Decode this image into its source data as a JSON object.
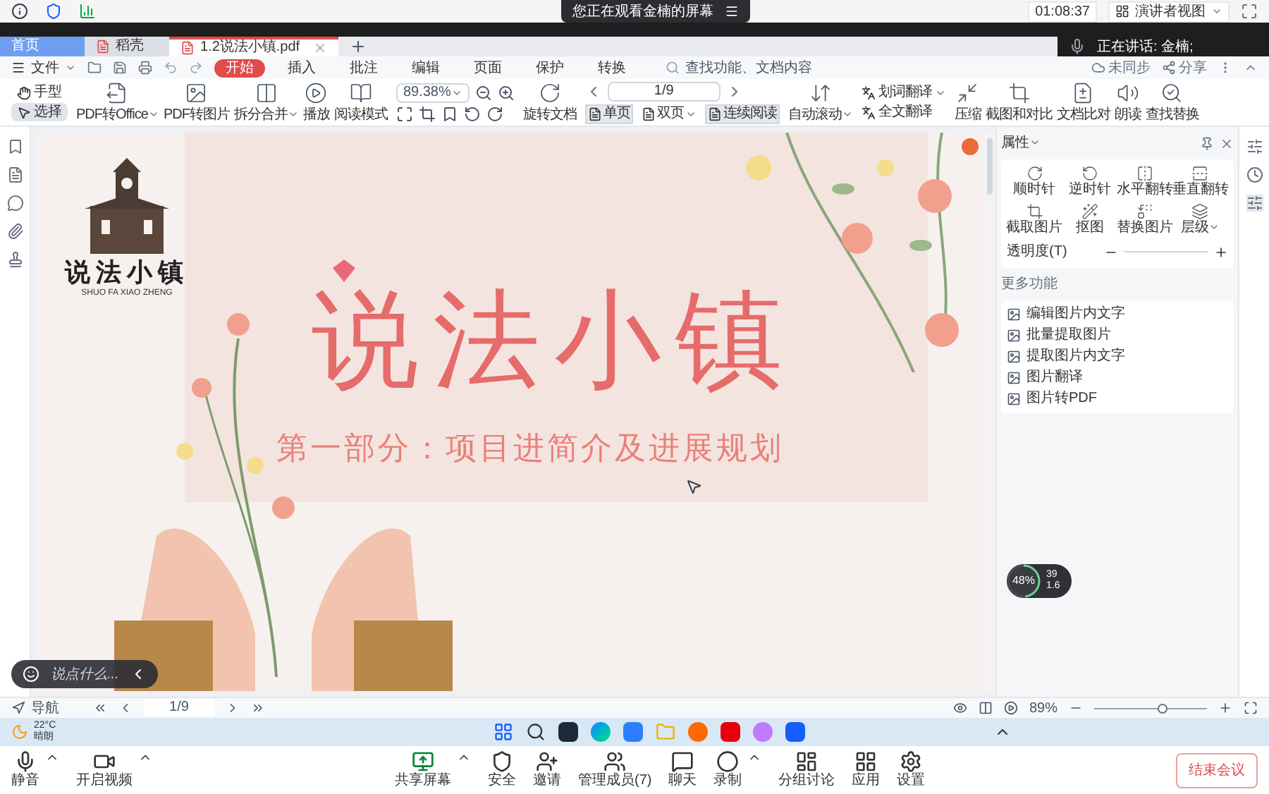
{
  "meeting_top": {
    "banner": "您正在观看金楠的屏幕",
    "time": "01:08:37",
    "view_button": "演讲者视图"
  },
  "speaking": {
    "label": "正在讲话: 金楠;"
  },
  "tabs": [
    {
      "label": "首页",
      "kind": "home",
      "selected": false
    },
    {
      "label": "稻壳",
      "kind": "app",
      "selected": false
    },
    {
      "label": "1.2说法小镇.pdf",
      "kind": "file",
      "selected": true
    }
  ],
  "menu": {
    "file": "文件",
    "items": [
      {
        "label": "开始",
        "selected": true
      },
      {
        "label": "插入",
        "selected": false
      },
      {
        "label": "批注",
        "selected": false
      },
      {
        "label": "编辑",
        "selected": false
      },
      {
        "label": "页面",
        "selected": false
      },
      {
        "label": "保护",
        "selected": false
      },
      {
        "label": "转换",
        "selected": false
      }
    ],
    "search": {
      "placeholder": "查找功能、文档内容"
    },
    "right": [
      "未同步",
      "分享"
    ]
  },
  "ribbon": [
    {
      "kind": "modes",
      "items": [
        {
          "label": "手型",
          "selected": false
        },
        {
          "label": "选择",
          "selected": true
        }
      ]
    },
    {
      "kind": "big",
      "label": "PDF转Office",
      "dropdown": true
    },
    {
      "kind": "big",
      "label": "PDF转图片",
      "dropdown": false
    },
    {
      "kind": "big",
      "label": "拆分合并",
      "dropdown": true
    },
    {
      "kind": "big",
      "label": "播放",
      "dropdown": false
    },
    {
      "kind": "big",
      "label": "阅读模式",
      "dropdown": false
    },
    {
      "kind": "zoom",
      "value": "89.38%"
    },
    {
      "kind": "big",
      "label": "旋转文档",
      "dropdown": false
    },
    {
      "kind": "pager",
      "value": "1/9",
      "items": [
        {
          "label": "单页",
          "selected": true,
          "dropdown": false
        },
        {
          "label": "双页",
          "selected": false,
          "dropdown": true
        },
        {
          "label": "连续阅读",
          "selected": true,
          "dropdown": false
        }
      ]
    },
    {
      "kind": "big",
      "label": "自动滚动",
      "dropdown": true
    },
    {
      "kind": "stack",
      "items": [
        {
          "label": "划词翻译",
          "dropdown": true
        },
        {
          "label": "全文翻译",
          "dropdown": false
        }
      ]
    },
    {
      "kind": "big",
      "label": "压缩",
      "dropdown": false
    },
    {
      "kind": "big",
      "label": "截图和对比",
      "dropdown": false
    },
    {
      "kind": "big",
      "label": "文档比对",
      "dropdown": false
    },
    {
      "kind": "big",
      "label": "朗读",
      "dropdown": false
    },
    {
      "kind": "big",
      "label": "查找替换",
      "dropdown": false
    }
  ],
  "slide": {
    "title": "说法小镇",
    "subtitle": "第一部分：项目进简介及进展规划",
    "logo_text": "说法小镇",
    "logo_subtext": "SHUO FA XIAO ZHENG"
  },
  "chat": {
    "placeholder": "说点什么..."
  },
  "network": {
    "percent": "48%",
    "level": 0.48,
    "up": "39",
    "down": "1.6"
  },
  "panel": {
    "title": "属性",
    "actions": [
      {
        "label": "顺时针",
        "dropdown": false
      },
      {
        "label": "逆时针",
        "dropdown": false
      },
      {
        "label": "水平翻转",
        "dropdown": false
      },
      {
        "label": "垂直翻转",
        "dropdown": false
      },
      {
        "label": "截取图片",
        "dropdown": false
      },
      {
        "label": "抠图",
        "dropdown": false
      },
      {
        "label": "替换图片",
        "dropdown": false
      },
      {
        "label": "层级",
        "dropdown": true
      }
    ],
    "opacity_label": "透明度(T)",
    "more_title": "更多功能",
    "more": [
      "编辑图片内文字",
      "批量提取图片",
      "提取图片内文字",
      "图片翻译",
      "图片转PDF"
    ]
  },
  "status_bar": {
    "nav": "导航",
    "page": "1/9",
    "zoom": "89%",
    "zoom_slider": {
      "level": 0.6
    }
  },
  "taskbar": {
    "temp": "22°C",
    "weather": "晴朗"
  },
  "meeting_toolbar": {
    "left": [
      {
        "label": "静音",
        "kind": "mic",
        "caret": true
      },
      {
        "label": "开启视频",
        "kind": "video",
        "caret": true
      }
    ],
    "center": [
      {
        "label": "共享屏幕",
        "kind": "share",
        "caret": true
      },
      {
        "label": "安全",
        "kind": "shield",
        "caret": false
      },
      {
        "label": "邀请",
        "kind": "invite",
        "caret": false
      },
      {
        "label": "管理成员(7)",
        "kind": "members",
        "caret": false
      },
      {
        "label": "聊天",
        "kind": "chat",
        "caret": false
      },
      {
        "label": "录制",
        "kind": "record",
        "caret": true
      },
      {
        "label": "分组讨论",
        "kind": "breakout",
        "caret": false
      },
      {
        "label": "应用",
        "kind": "apps",
        "caret": false
      },
      {
        "label": "设置",
        "kind": "settings",
        "caret": false
      }
    ],
    "end_button": "结束会议"
  }
}
